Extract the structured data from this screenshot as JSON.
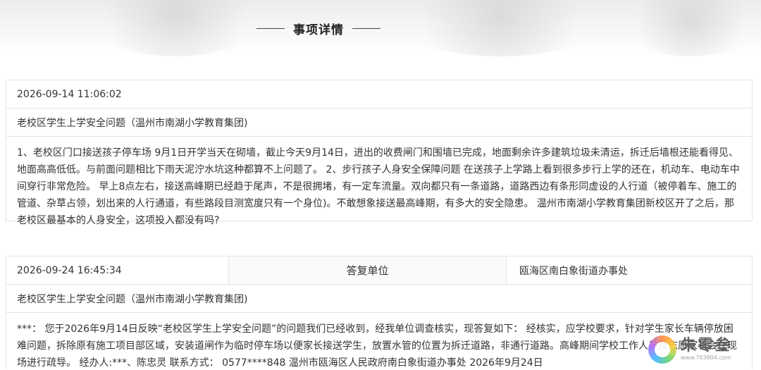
{
  "header": {
    "section_title": "事项详情"
  },
  "complaint": {
    "datetime": "2026-09-14 11:06:02",
    "title": "老校区学生上学安全问题（温州市南湖小学教育集团)",
    "content": "1、老校区门口接送孩子停车场 9月1日开学当天在砌墙，截止今天9月14日，进出的收费闸门和围墙已完成，地面剩余许多建筑垃圾未清运，拆迁后墙根还能看得见、地面高高低低。与前面问题相比下雨天泥泞水坑这种都算不上问题了。 2、步行孩子人身安全保障问题 在送孩子上学路上看到很多步行上学的还在，机动车、电动车中间穿行非常危险。 早上8点左右，接送高峰期已经趋于尾声，不是很拥堵，有一定车流量。双向都只有一条道路，道路西边有条形同虚设的人行道（被停着车、施工的管道、杂草占领，划出来的人行通道，有些路段目测宽度只有一个身位)。不敢想象接送最高峰期，有多大的安全隐患。 温州市南湖小学教育集团新校区开了之后，那老校区最基本的人身安全，这项投入都没有吗?"
  },
  "reply": {
    "datetime": "2026-09-24 16:45:34",
    "unit_label": "答复单位",
    "unit_value": "瓯海区南白象街道办事处",
    "title": "老校区学生上学安全问题（温州市南湖小学教育集团)",
    "content": "***： 您于2026年9月14日反映“老校区学生上学安全问题”的问题我们已经收到，经我单位调查核实，现答复如下： 经核实，应学校要求，针对学生家长车辆停放困难问题，拆除原有施工项目部区域，安装道闸作为临时停车场以便家长接送学生，放置水管的位置为拆迁道路，非通行道路。高峰期间学校工作人员及志愿家长会在现场进行疏导。 经办人:***、陈忠灵 联系方式： 0577****848 温州市瓯海区人民政府南白象街道办事处 2026年9月24日"
  },
  "watermark": {
    "name": "朱零叁",
    "url": "www.703804.com"
  }
}
